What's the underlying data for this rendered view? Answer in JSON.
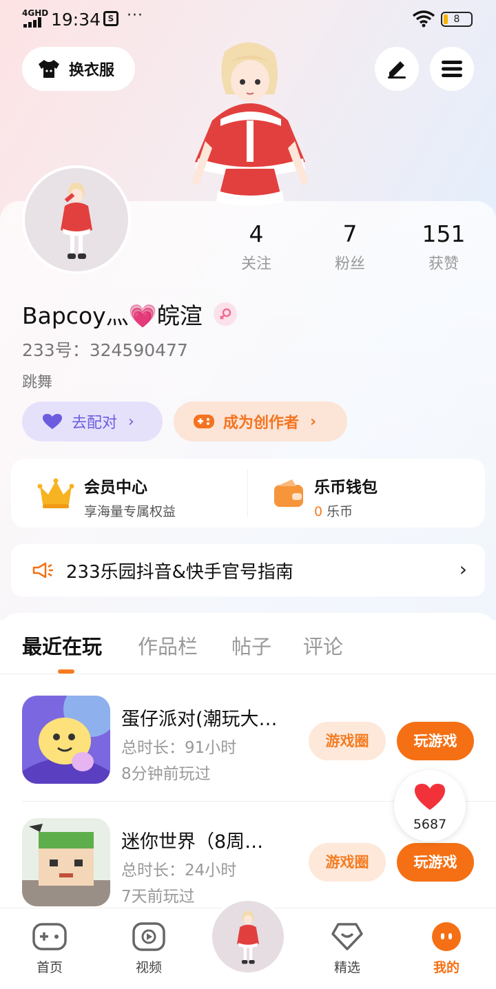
{
  "status_bar": {
    "network": "4GHD",
    "time": "19:34",
    "battery": "8"
  },
  "header": {
    "dress_button_label": "换衣服"
  },
  "profile": {
    "stats": [
      {
        "value": "4",
        "label": "关注"
      },
      {
        "value": "7",
        "label": "粉丝"
      },
      {
        "value": "151",
        "label": "获赞"
      }
    ],
    "nickname": "Bapcoy灬💗皖渲",
    "uid_label": "233号：324590477",
    "bio": "跳舞",
    "match_button": "去配对",
    "creator_button": "成为创作者"
  },
  "services": {
    "vip_title": "会员中心",
    "vip_sub": "享海量专属权益",
    "wallet_title": "乐币钱包",
    "wallet_amount": "0",
    "wallet_unit": "乐币"
  },
  "guide": {
    "text": "233乐园抖音&快手官号指南"
  },
  "tabs": [
    {
      "label": "最近在玩",
      "active": true
    },
    {
      "label": "作品栏",
      "active": false
    },
    {
      "label": "帖子",
      "active": false
    },
    {
      "label": "评论",
      "active": false
    }
  ],
  "games": [
    {
      "name": "蛋仔派对(潮玩大…",
      "duration": "总时长：91小时",
      "last_played": "8分钟前玩过",
      "circle_button": "游戏圈",
      "play_button": "玩游戏"
    },
    {
      "name": "迷你世界（8周…",
      "duration": "总时长：24小时",
      "last_played": "7天前玩过",
      "circle_button": "游戏圈",
      "play_button": "玩游戏"
    }
  ],
  "like_float": {
    "count": "5687"
  },
  "bottom_nav": [
    {
      "label": "首页",
      "icon": "gamepad-icon"
    },
    {
      "label": "视频",
      "icon": "video-play-icon"
    },
    {
      "label": "",
      "icon": "avatar-center"
    },
    {
      "label": "精选",
      "icon": "heart-diamond-icon"
    },
    {
      "label": "我的",
      "icon": "profile-face-icon"
    }
  ],
  "colors": {
    "accent": "#f57014",
    "match_purple": "#6b5ce0",
    "muted_text": "#999999"
  }
}
